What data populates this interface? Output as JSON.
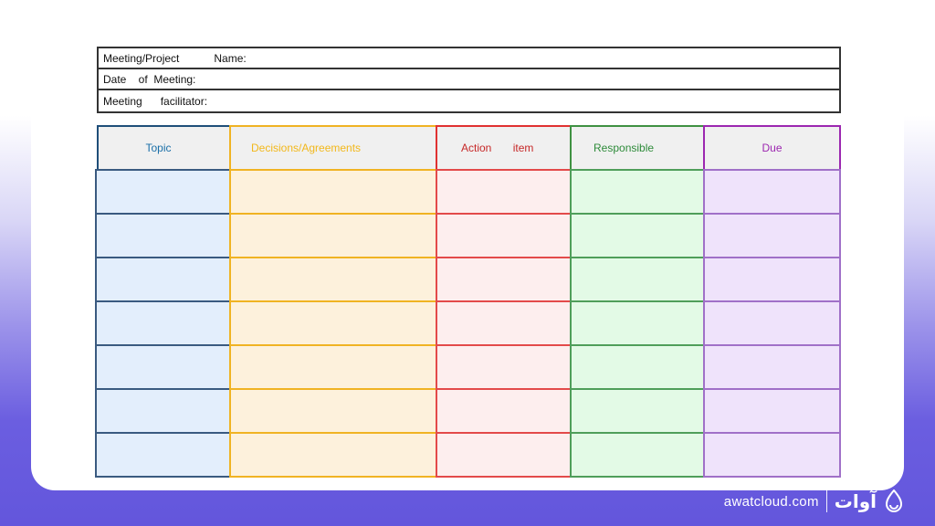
{
  "info": {
    "meeting_project_label": "Meeting/Project",
    "name_label": "Name:",
    "date_label": "Date    of  Meeting:",
    "facilitator_label": "Meeting      facilitator:"
  },
  "table": {
    "headers": [
      "Topic",
      "Decisions/Agreements",
      "Action       item",
      "Responsible",
      "Due"
    ],
    "header_colors": [
      "#1a6fa8",
      "#f2b81b",
      "#c62828",
      "#2e8b3a",
      "#9c27b0"
    ],
    "rows": 7
  },
  "footer": {
    "site": "awatcloud.com",
    "brand": "آوات",
    "logo_icon": "cloud-drop-icon"
  }
}
